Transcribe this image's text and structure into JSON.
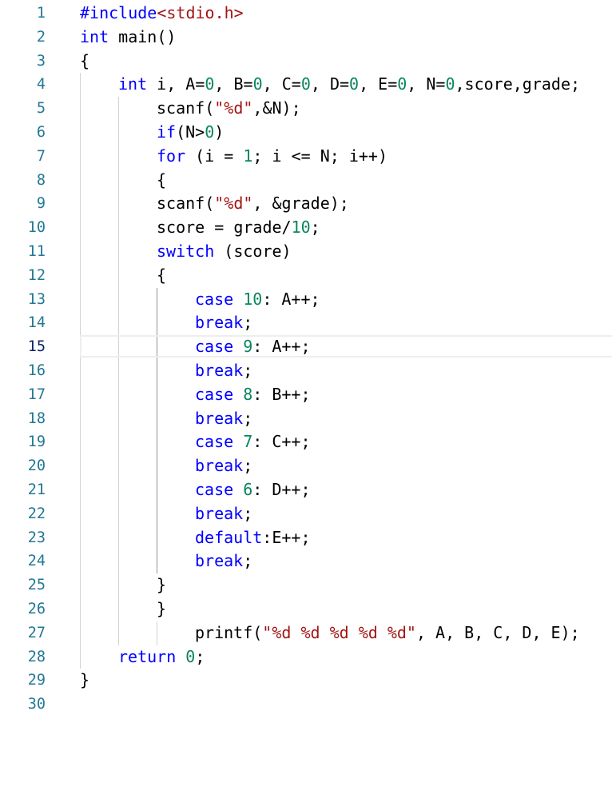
{
  "editor": {
    "current_line": 15,
    "colors": {
      "background": "#ffffff",
      "line_number": "#237893",
      "line_number_active": "#0b216f",
      "keyword": "#0000ff",
      "string": "#a31515",
      "number": "#098658",
      "text": "#000000",
      "indent_guide": "#d3d3d3",
      "indent_guide_active": "#939393",
      "current_line_border": "#eeeeee"
    },
    "lines": [
      {
        "n": "1",
        "indent": 1,
        "tokens": [
          {
            "t": "kw",
            "v": "#include"
          },
          {
            "t": "str",
            "v": "<stdio.h>"
          }
        ]
      },
      {
        "n": "2",
        "indent": 1,
        "tokens": [
          {
            "t": "kw",
            "v": "int"
          },
          {
            "t": "txt",
            "v": " main()"
          }
        ]
      },
      {
        "n": "3",
        "indent": 1,
        "tokens": [
          {
            "t": "txt",
            "v": "{"
          }
        ]
      },
      {
        "n": "4",
        "indent": 2,
        "tokens": [
          {
            "t": "kw",
            "v": "int"
          },
          {
            "t": "txt",
            "v": " i, A="
          },
          {
            "t": "num",
            "v": "0"
          },
          {
            "t": "txt",
            "v": ", B="
          },
          {
            "t": "num",
            "v": "0"
          },
          {
            "t": "txt",
            "v": ", C="
          },
          {
            "t": "num",
            "v": "0"
          },
          {
            "t": "txt",
            "v": ", D="
          },
          {
            "t": "num",
            "v": "0"
          },
          {
            "t": "txt",
            "v": ", E="
          },
          {
            "t": "num",
            "v": "0"
          },
          {
            "t": "txt",
            "v": ", N="
          },
          {
            "t": "num",
            "v": "0"
          },
          {
            "t": "txt",
            "v": ",score,grade;"
          }
        ]
      },
      {
        "n": "5",
        "indent": 3,
        "tokens": [
          {
            "t": "txt",
            "v": "scanf("
          },
          {
            "t": "str",
            "v": "\"%d\""
          },
          {
            "t": "txt",
            "v": ",&N);"
          }
        ]
      },
      {
        "n": "6",
        "indent": 3,
        "tokens": [
          {
            "t": "kw",
            "v": "if"
          },
          {
            "t": "txt",
            "v": "(N>"
          },
          {
            "t": "num",
            "v": "0"
          },
          {
            "t": "txt",
            "v": ")"
          }
        ]
      },
      {
        "n": "7",
        "indent": 3,
        "tokens": [
          {
            "t": "kw",
            "v": "for"
          },
          {
            "t": "txt",
            "v": " (i = "
          },
          {
            "t": "num",
            "v": "1"
          },
          {
            "t": "txt",
            "v": "; i <= N; i++)"
          }
        ]
      },
      {
        "n": "8",
        "indent": 3,
        "tokens": [
          {
            "t": "txt",
            "v": "{"
          }
        ]
      },
      {
        "n": "9",
        "indent": 3,
        "tokens": [
          {
            "t": "txt",
            "v": "scanf("
          },
          {
            "t": "str",
            "v": "\"%d\""
          },
          {
            "t": "txt",
            "v": ", &grade);"
          }
        ]
      },
      {
        "n": "10",
        "indent": 3,
        "tokens": [
          {
            "t": "txt",
            "v": "score = grade/"
          },
          {
            "t": "num",
            "v": "10"
          },
          {
            "t": "txt",
            "v": ";"
          }
        ]
      },
      {
        "n": "11",
        "indent": 3,
        "tokens": [
          {
            "t": "kw",
            "v": "switch"
          },
          {
            "t": "txt",
            "v": " (score)"
          }
        ]
      },
      {
        "n": "12",
        "indent": 3,
        "tokens": [
          {
            "t": "txt",
            "v": "{"
          }
        ]
      },
      {
        "n": "13",
        "indent": 4,
        "tokens": [
          {
            "t": "kw",
            "v": "case"
          },
          {
            "t": "txt",
            "v": " "
          },
          {
            "t": "num",
            "v": "10"
          },
          {
            "t": "txt",
            "v": ": A++;"
          }
        ]
      },
      {
        "n": "14",
        "indent": 4,
        "tokens": [
          {
            "t": "kw",
            "v": "break"
          },
          {
            "t": "txt",
            "v": ";"
          }
        ]
      },
      {
        "n": "15",
        "indent": 4,
        "tokens": [
          {
            "t": "kw",
            "v": "case"
          },
          {
            "t": "txt",
            "v": " "
          },
          {
            "t": "num",
            "v": "9"
          },
          {
            "t": "txt",
            "v": ": A++;"
          }
        ]
      },
      {
        "n": "16",
        "indent": 4,
        "tokens": [
          {
            "t": "kw",
            "v": "break"
          },
          {
            "t": "txt",
            "v": ";"
          }
        ]
      },
      {
        "n": "17",
        "indent": 4,
        "tokens": [
          {
            "t": "kw",
            "v": "case"
          },
          {
            "t": "txt",
            "v": " "
          },
          {
            "t": "num",
            "v": "8"
          },
          {
            "t": "txt",
            "v": ": B++;"
          }
        ]
      },
      {
        "n": "18",
        "indent": 4,
        "tokens": [
          {
            "t": "kw",
            "v": "break"
          },
          {
            "t": "txt",
            "v": ";"
          }
        ]
      },
      {
        "n": "19",
        "indent": 4,
        "tokens": [
          {
            "t": "kw",
            "v": "case"
          },
          {
            "t": "txt",
            "v": " "
          },
          {
            "t": "num",
            "v": "7"
          },
          {
            "t": "txt",
            "v": ": C++;"
          }
        ]
      },
      {
        "n": "20",
        "indent": 4,
        "tokens": [
          {
            "t": "kw",
            "v": "break"
          },
          {
            "t": "txt",
            "v": ";"
          }
        ]
      },
      {
        "n": "21",
        "indent": 4,
        "tokens": [
          {
            "t": "kw",
            "v": "case"
          },
          {
            "t": "txt",
            "v": " "
          },
          {
            "t": "num",
            "v": "6"
          },
          {
            "t": "txt",
            "v": ": D++;"
          }
        ]
      },
      {
        "n": "22",
        "indent": 4,
        "tokens": [
          {
            "t": "kw",
            "v": "break"
          },
          {
            "t": "txt",
            "v": ";"
          }
        ]
      },
      {
        "n": "23",
        "indent": 4,
        "tokens": [
          {
            "t": "kw",
            "v": "default"
          },
          {
            "t": "txt",
            "v": ":E++;"
          }
        ]
      },
      {
        "n": "24",
        "indent": 4,
        "tokens": [
          {
            "t": "kw",
            "v": "break"
          },
          {
            "t": "txt",
            "v": ";"
          }
        ]
      },
      {
        "n": "25",
        "indent": 3,
        "tokens": [
          {
            "t": "txt",
            "v": "}"
          }
        ]
      },
      {
        "n": "26",
        "indent": 3,
        "tokens": [
          {
            "t": "txt",
            "v": "}"
          }
        ]
      },
      {
        "n": "27",
        "indent": 4,
        "tokens": [
          {
            "t": "txt",
            "v": "printf("
          },
          {
            "t": "str",
            "v": "\"%d %d %d %d %d\""
          },
          {
            "t": "txt",
            "v": ", A, B, C, D, E);"
          }
        ]
      },
      {
        "n": "28",
        "indent": 2,
        "tokens": [
          {
            "t": "kw",
            "v": "return"
          },
          {
            "t": "txt",
            "v": " "
          },
          {
            "t": "num",
            "v": "0"
          },
          {
            "t": "txt",
            "v": ";"
          }
        ]
      },
      {
        "n": "29",
        "indent": 1,
        "tokens": [
          {
            "t": "txt",
            "v": "}"
          }
        ]
      },
      {
        "n": "30",
        "indent": 0,
        "tokens": []
      }
    ]
  }
}
